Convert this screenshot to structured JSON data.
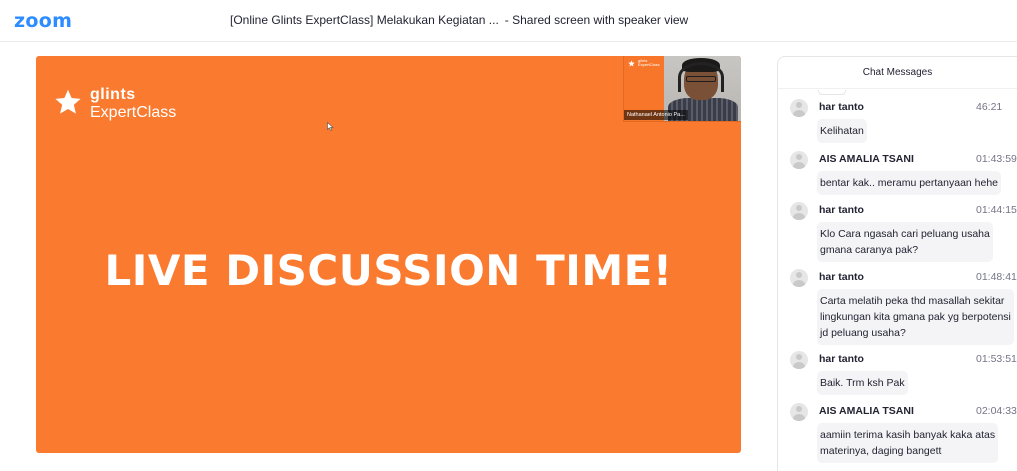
{
  "app": {
    "logo": "zoom",
    "window_title": "[Online Glints ExpertClass] Melakukan Kegiatan ...",
    "view_label": "- Shared screen with speaker view"
  },
  "slide": {
    "brand_line1": "glints",
    "brand_line2": "ExpertClass",
    "headline": "LIVE DISCUSSION TIME!",
    "accent_color": "#fa7b2f"
  },
  "speaker": {
    "name": "Nathanael Antonio Pa..."
  },
  "chat": {
    "header": "Chat Messages",
    "messages": [
      {
        "sender": "har tanto",
        "time": "46:21",
        "lines": [
          "Kelihatan"
        ]
      },
      {
        "sender": "AIS AMALIA TSANI",
        "time": "01:43:59",
        "lines": [
          "bentar kak.. meramu pertanyaan hehe"
        ]
      },
      {
        "sender": "har tanto",
        "time": "01:44:15",
        "lines": [
          "Klo Cara ngasah cari peluang usaha",
          "gmana caranya pak?"
        ]
      },
      {
        "sender": "har tanto",
        "time": "01:48:41",
        "lines": [
          "Carta melatih peka thd masallah sekitar",
          "lingkungan kita gmana pak yg berpotensi",
          "jd peluang usaha?"
        ]
      },
      {
        "sender": "har tanto",
        "time": "01:53:51",
        "lines": [
          "Baik. Trm ksh Pak"
        ]
      },
      {
        "sender": "AIS AMALIA TSANI",
        "time": "02:04:33",
        "lines": [
          "aamiin terima kasih banyak kaka atas",
          "materinya, daging bangett"
        ]
      }
    ]
  }
}
